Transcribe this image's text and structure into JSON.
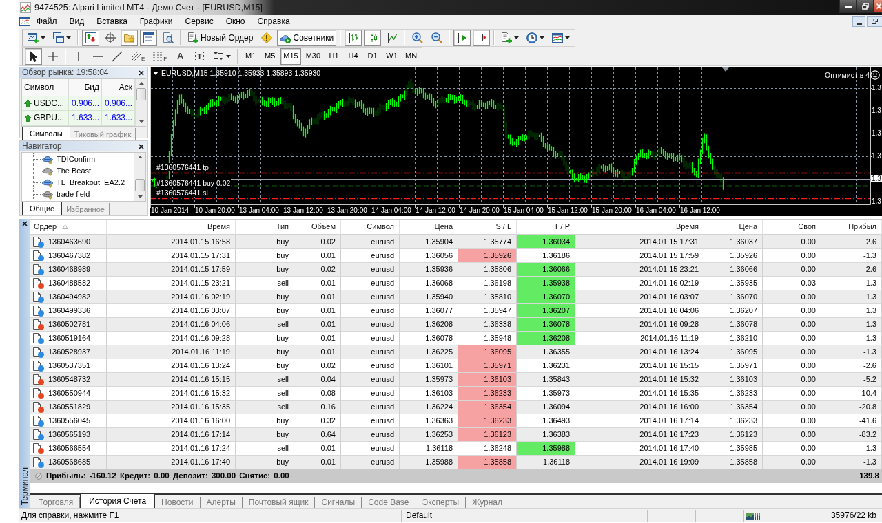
{
  "window": {
    "title": "9474525: Alpari Limited MT4 - Демо Счет - [EURUSD,M15]"
  },
  "menu": [
    "Файл",
    "Вид",
    "Вставка",
    "Графики",
    "Сервис",
    "Окно",
    "Справка"
  ],
  "standard_toolbar": {
    "groups": [
      [
        {
          "kind": "newchart",
          "pressed": false
        },
        {
          "kind": "profiles",
          "pressed": false
        }
      ],
      [
        {
          "kind": "marketwatch",
          "pressed": true
        },
        {
          "kind": "datawindow",
          "pressed": false
        },
        {
          "kind": "navigator",
          "pressed": true
        },
        {
          "kind": "terminal",
          "pressed": true
        },
        {
          "kind": "tester",
          "pressed": false
        }
      ],
      [
        {
          "kind": "order",
          "label": "Новый Ордер",
          "pressed": false
        },
        {
          "kind": "autotrading",
          "pressed": false
        },
        {
          "kind": "experts",
          "label": "Советники",
          "pressed": true
        }
      ],
      [
        {
          "kind": "bars",
          "pressed": true
        },
        {
          "kind": "candles",
          "pressed": true
        },
        {
          "kind": "line",
          "pressed": false
        }
      ],
      [
        {
          "kind": "zoomin",
          "pressed": false
        },
        {
          "kind": "zoomout",
          "pressed": false
        }
      ],
      [
        {
          "kind": "shift",
          "pressed": true
        },
        {
          "kind": "autoscroll",
          "pressed": true
        }
      ],
      [
        {
          "kind": "indicators",
          "pressed": false
        },
        {
          "kind": "periods",
          "pressed": false
        },
        {
          "kind": "templates",
          "pressed": false
        }
      ]
    ]
  },
  "tools_toolbar": {
    "groups": [
      [
        {
          "kind": "cursor",
          "pressed": true
        },
        {
          "kind": "crosshair",
          "pressed": false
        }
      ],
      [
        {
          "kind": "vline",
          "pressed": false
        },
        {
          "kind": "hline",
          "pressed": false
        },
        {
          "kind": "trendline",
          "pressed": false
        },
        {
          "kind": "channel",
          "label": "E",
          "pressed": false
        },
        {
          "kind": "fibo",
          "label": "F",
          "pressed": false
        },
        {
          "kind": "text",
          "label": "A",
          "pressed": false
        },
        {
          "kind": "textlabel",
          "label": "T",
          "pressed": false
        },
        {
          "kind": "arrows",
          "pressed": false
        }
      ]
    ]
  },
  "timeframes": [
    {
      "label": "M1",
      "selected": false
    },
    {
      "label": "M5",
      "selected": false
    },
    {
      "label": "M15",
      "selected": true
    },
    {
      "label": "M30",
      "selected": false
    },
    {
      "label": "H1",
      "selected": false
    },
    {
      "label": "H4",
      "selected": false
    },
    {
      "label": "D1",
      "selected": false
    },
    {
      "label": "W1",
      "selected": false
    },
    {
      "label": "MN",
      "selected": false
    }
  ],
  "market_watch": {
    "title": "Обзор рынка: 19:58:04",
    "columns": [
      "Символ",
      "Бид",
      "Аск"
    ],
    "rows": [
      {
        "symbol": "USDC...",
        "bid": "0.906...",
        "ask": "0.906...",
        "up": true
      },
      {
        "symbol": "GBPU...",
        "bid": "1.633...",
        "ask": "1.633...",
        "up": true
      }
    ],
    "tabs": [
      {
        "label": "Символы",
        "selected": true
      },
      {
        "label": "Тиковый график",
        "selected": false
      }
    ]
  },
  "navigator": {
    "title": "Навигатор",
    "items": [
      {
        "label": "TDIConfirm",
        "active": true
      },
      {
        "label": "The Beast",
        "active": false
      },
      {
        "label": "TL_Breakout_EA2.2",
        "active": true
      },
      {
        "label": "trade field",
        "active": false
      }
    ],
    "tabs": [
      {
        "label": "Общие",
        "selected": true
      },
      {
        "label": "Избранное",
        "selected": false
      }
    ]
  },
  "chart": {
    "header": "EURUSD,M15 1.35910 1.35933 1.35893 1.35930",
    "expert": "Оптимист в 4",
    "order_lines": [
      {
        "kind": "tp",
        "label": "#1360576441 tp"
      },
      {
        "kind": "open",
        "label": "#1360576441 buy 0.02"
      },
      {
        "kind": "sl",
        "label": "#1360576441 sl"
      }
    ],
    "price_labels": [
      {
        "text": "1.3",
        "current": false
      },
      {
        "text": "1.3",
        "current": false
      },
      {
        "text": "1.3",
        "current": false
      },
      {
        "text": "1.3",
        "current": false
      },
      {
        "text": "1.3",
        "current": true
      },
      {
        "text": "1.3",
        "current": false
      }
    ],
    "time_labels": [
      "10 Jan 2014",
      "10 Jan 20:00",
      "13 Jan 04:00",
      "13 Jan 12:00",
      "13 Jan 20:00",
      "14 Jan 04:00",
      "14 Jan 12:00",
      "14 Jan 20:00",
      "15 Jan 04:00",
      "15 Jan 12:00",
      "15 Jan 20:00",
      "16 Jan 04:00",
      "16 Jan 12:00"
    ]
  },
  "terminal": {
    "title": "Терминал",
    "columns": [
      {
        "label": "Ордер",
        "sorted": true
      },
      {
        "label": "Время",
        "sorted": false
      },
      {
        "label": "Тип",
        "sorted": false
      },
      {
        "label": "Объём",
        "sorted": false
      },
      {
        "label": "Символ",
        "sorted": false
      },
      {
        "label": "Цена",
        "sorted": false
      },
      {
        "label": "S / L",
        "sorted": false
      },
      {
        "label": "T / P",
        "sorted": false
      },
      {
        "label": "Время",
        "sorted": false
      },
      {
        "label": "Цена",
        "sorted": false
      },
      {
        "label": "Своп",
        "sorted": false
      },
      {
        "label": "Прибыл",
        "sorted": false
      }
    ],
    "rows": [
      {
        "order": "1360463690",
        "open_time": "2014.01.15 16:58",
        "type": "buy",
        "volume": "0.02",
        "symbol": "eurusd",
        "open_price": "1.35904",
        "sl": "1.35774",
        "tp": "1.36034",
        "close_time": "2014.01.15 17:31",
        "close_price": "1.36037",
        "swap": "0.00",
        "profit": "2.6",
        "color": "#2b8ae2",
        "sl_hit": false,
        "tp_hit": true
      },
      {
        "order": "1360467382",
        "open_time": "2014.01.15 17:31",
        "type": "buy",
        "volume": "0.01",
        "symbol": "eurusd",
        "open_price": "1.36056",
        "sl": "1.35926",
        "tp": "1.36186",
        "close_time": "2014.01.15 17:59",
        "close_price": "1.35926",
        "swap": "0.00",
        "profit": "-1.3",
        "color": "#2b8ae2",
        "sl_hit": true,
        "tp_hit": false
      },
      {
        "order": "1360468989",
        "open_time": "2014.01.15 17:59",
        "type": "buy",
        "volume": "0.02",
        "symbol": "eurusd",
        "open_price": "1.35936",
        "sl": "1.35806",
        "tp": "1.36066",
        "close_time": "2014.01.15 23:21",
        "close_price": "1.36066",
        "swap": "0.00",
        "profit": "2.6",
        "color": "#2b8ae2",
        "sl_hit": false,
        "tp_hit": true
      },
      {
        "order": "1360488582",
        "open_time": "2014.01.15 23:21",
        "type": "sell",
        "volume": "0.01",
        "symbol": "eurusd",
        "open_price": "1.36068",
        "sl": "1.36198",
        "tp": "1.35938",
        "close_time": "2014.01.16 02:19",
        "close_price": "1.35935",
        "swap": "-0.03",
        "profit": "1.3",
        "color": "#e5461f",
        "sl_hit": false,
        "tp_hit": true
      },
      {
        "order": "1360494982",
        "open_time": "2014.01.16 02:19",
        "type": "buy",
        "volume": "0.01",
        "symbol": "eurusd",
        "open_price": "1.35940",
        "sl": "1.35810",
        "tp": "1.36070",
        "close_time": "2014.01.16 03:07",
        "close_price": "1.36070",
        "swap": "0.00",
        "profit": "1.3",
        "color": "#2b8ae2",
        "sl_hit": false,
        "tp_hit": true
      },
      {
        "order": "1360499336",
        "open_time": "2014.01.16 03:07",
        "type": "buy",
        "volume": "0.01",
        "symbol": "eurusd",
        "open_price": "1.36077",
        "sl": "1.35947",
        "tp": "1.36207",
        "close_time": "2014.01.16 04:06",
        "close_price": "1.36207",
        "swap": "0.00",
        "profit": "1.3",
        "color": "#2b8ae2",
        "sl_hit": false,
        "tp_hit": true
      },
      {
        "order": "1360502781",
        "open_time": "2014.01.16 04:06",
        "type": "sell",
        "volume": "0.01",
        "symbol": "eurusd",
        "open_price": "1.36208",
        "sl": "1.36338",
        "tp": "1.36078",
        "close_time": "2014.01.16 09:28",
        "close_price": "1.36078",
        "swap": "0.00",
        "profit": "1.3",
        "color": "#e5461f",
        "sl_hit": false,
        "tp_hit": true
      },
      {
        "order": "1360519164",
        "open_time": "2014.01.16 09:28",
        "type": "buy",
        "volume": "0.01",
        "symbol": "eurusd",
        "open_price": "1.36078",
        "sl": "1.35948",
        "tp": "1.36208",
        "close_time": "2014.01.16 11:19",
        "close_price": "1.36210",
        "swap": "0.00",
        "profit": "1.3",
        "color": "#2b8ae2",
        "sl_hit": false,
        "tp_hit": true
      },
      {
        "order": "1360528937",
        "open_time": "2014.01.16 11:19",
        "type": "buy",
        "volume": "0.01",
        "symbol": "eurusd",
        "open_price": "1.36225",
        "sl": "1.36095",
        "tp": "1.36355",
        "close_time": "2014.01.16 13:24",
        "close_price": "1.36095",
        "swap": "0.00",
        "profit": "-1.3",
        "color": "#2b8ae2",
        "sl_hit": true,
        "tp_hit": false
      },
      {
        "order": "1360537351",
        "open_time": "2014.01.16 13:24",
        "type": "buy",
        "volume": "0.02",
        "symbol": "eurusd",
        "open_price": "1.36101",
        "sl": "1.35971",
        "tp": "1.36231",
        "close_time": "2014.01.16 15:15",
        "close_price": "1.35971",
        "swap": "0.00",
        "profit": "-2.6",
        "color": "#2b8ae2",
        "sl_hit": true,
        "tp_hit": false
      },
      {
        "order": "1360548732",
        "open_time": "2014.01.16 15:15",
        "type": "sell",
        "volume": "0.04",
        "symbol": "eurusd",
        "open_price": "1.35973",
        "sl": "1.36103",
        "tp": "1.35843",
        "close_time": "2014.01.16 15:32",
        "close_price": "1.36103",
        "swap": "0.00",
        "profit": "-5.2",
        "color": "#e5461f",
        "sl_hit": true,
        "tp_hit": false
      },
      {
        "order": "1360550944",
        "open_time": "2014.01.16 15:32",
        "type": "sell",
        "volume": "0.08",
        "symbol": "eurusd",
        "open_price": "1.36103",
        "sl": "1.36233",
        "tp": "1.35973",
        "close_time": "2014.01.16 15:35",
        "close_price": "1.36233",
        "swap": "0.00",
        "profit": "-10.4",
        "color": "#e5461f",
        "sl_hit": true,
        "tp_hit": false
      },
      {
        "order": "1360551829",
        "open_time": "2014.01.16 15:35",
        "type": "sell",
        "volume": "0.16",
        "symbol": "eurusd",
        "open_price": "1.36224",
        "sl": "1.36354",
        "tp": "1.36094",
        "close_time": "2014.01.16 16:00",
        "close_price": "1.36354",
        "swap": "0.00",
        "profit": "-20.8",
        "color": "#e5461f",
        "sl_hit": true,
        "tp_hit": false
      },
      {
        "order": "1360556045",
        "open_time": "2014.01.16 16:00",
        "type": "buy",
        "volume": "0.32",
        "symbol": "eurusd",
        "open_price": "1.36363",
        "sl": "1.36233",
        "tp": "1.36493",
        "close_time": "2014.01.16 17:14",
        "close_price": "1.36233",
        "swap": "0.00",
        "profit": "-41.6",
        "color": "#2b8ae2",
        "sl_hit": true,
        "tp_hit": false
      },
      {
        "order": "1360565193",
        "open_time": "2014.01.16 17:14",
        "type": "buy",
        "volume": "0.64",
        "symbol": "eurusd",
        "open_price": "1.36253",
        "sl": "1.36123",
        "tp": "1.36383",
        "close_time": "2014.01.16 17:23",
        "close_price": "1.36123",
        "swap": "0.00",
        "profit": "-83.2",
        "color": "#2b8ae2",
        "sl_hit": true,
        "tp_hit": false
      },
      {
        "order": "1360566554",
        "open_time": "2014.01.16 17:24",
        "type": "sell",
        "volume": "0.01",
        "symbol": "eurusd",
        "open_price": "1.36118",
        "sl": "1.36248",
        "tp": "1.35988",
        "close_time": "2014.01.16 17:40",
        "close_price": "1.35985",
        "swap": "0.00",
        "profit": "1.3",
        "color": "#e5461f",
        "sl_hit": false,
        "tp_hit": true
      },
      {
        "order": "1360568685",
        "open_time": "2014.01.16 17:40",
        "type": "buy",
        "volume": "0.01",
        "symbol": "eurusd",
        "open_price": "1.35988",
        "sl": "1.35858",
        "tp": "1.36118",
        "close_time": "2014.01.16 19:09",
        "close_price": "1.35858",
        "swap": "0.00",
        "profit": "-1.3",
        "color": "#2b8ae2",
        "sl_hit": true,
        "tp_hit": false
      }
    ],
    "summary": {
      "text": "Прибыль: -160.12 Кредит: 0.00 Депозит: 300.00 Снятие: 0.00",
      "total": "139.8"
    },
    "tabs": [
      {
        "label": "Торговля",
        "selected": false
      },
      {
        "label": "История Счета",
        "selected": true
      },
      {
        "label": "Новости",
        "selected": false
      },
      {
        "label": "Алерты",
        "selected": false
      },
      {
        "label": "Почтовый ящик",
        "selected": false
      },
      {
        "label": "Сигналы",
        "selected": false
      },
      {
        "label": "Code Base",
        "selected": false
      },
      {
        "label": "Эксперты",
        "selected": false
      },
      {
        "label": "Журнал",
        "selected": false
      }
    ]
  },
  "status_bar": {
    "help": "Для справки, нажмите F1",
    "profile": "Default",
    "traffic": "35976/22 kb"
  }
}
